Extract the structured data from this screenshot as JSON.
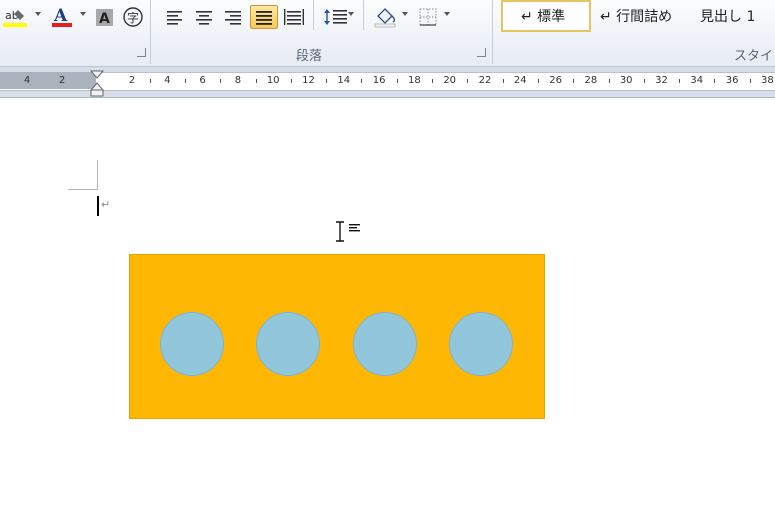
{
  "ribbon": {
    "paragraph_group_label": "段落",
    "style_group_label": "スタイル",
    "styles": [
      "↵ 標準",
      "↵ 行間詰め",
      "見出し 1"
    ],
    "font_color_glyph": "A",
    "char_shading_glyph": "A",
    "enclose_char_glyph": "字",
    "highlight_glyph": "ab"
  },
  "ruler": {
    "labels": [
      "4",
      "2",
      "2",
      "4",
      "6",
      "8",
      "10",
      "12",
      "14",
      "16",
      "18",
      "20",
      "22",
      "24",
      "26",
      "28",
      "30",
      "32",
      "34",
      "36",
      "38"
    ]
  },
  "document": {
    "paragraph_mark": "↵",
    "rectangle_color": "#feb803",
    "circle_color": "#92c6db",
    "circle_count": 4
  }
}
